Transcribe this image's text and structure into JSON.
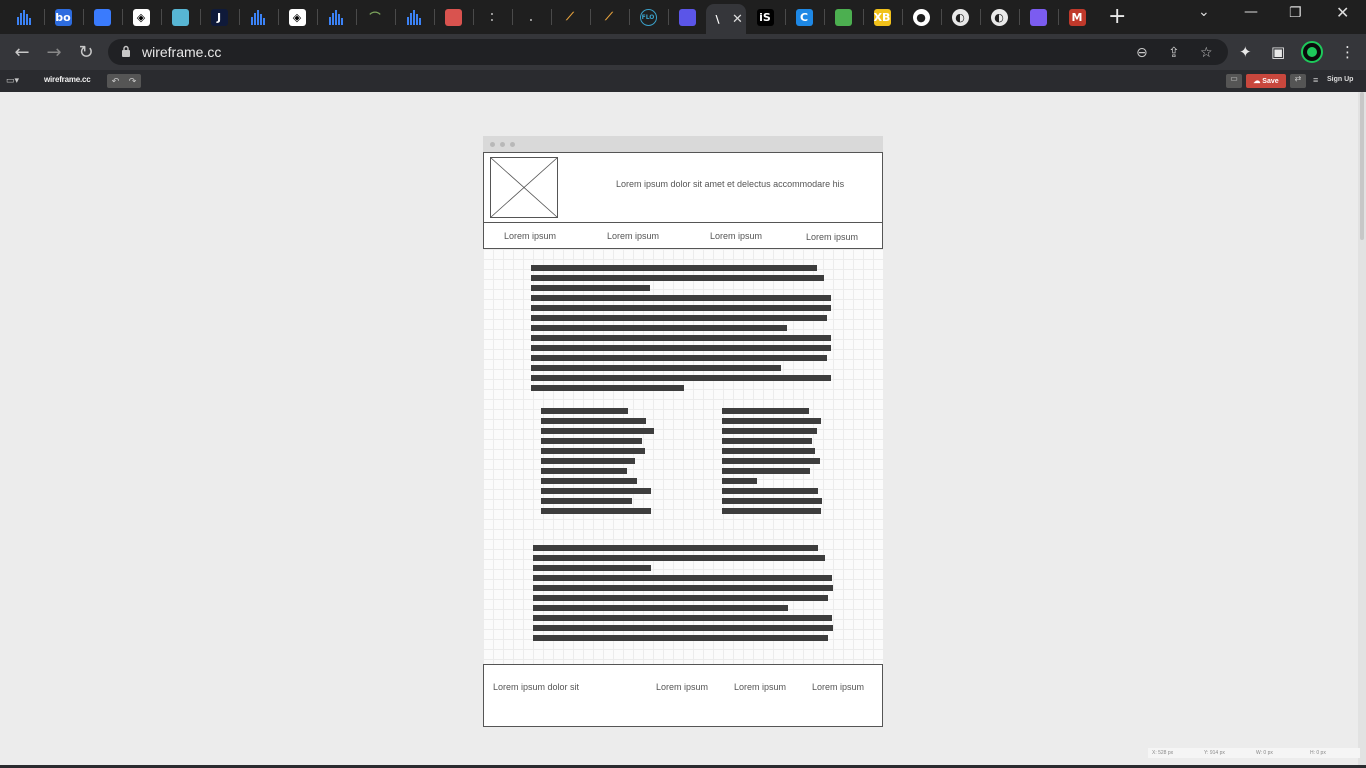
{
  "browser": {
    "url": "wireframe.cc",
    "tabs": [
      {
        "icon": "bar-chart-icon",
        "color": "#3b82f6"
      },
      {
        "icon": "bo-icon",
        "label": "bo",
        "color": "#2d6cdf"
      },
      {
        "icon": "pen-icon",
        "color": "#3a7bfd"
      },
      {
        "icon": "codepen-icon",
        "color": "#ffffff"
      },
      {
        "icon": "image-icon",
        "color": "#57b6d4"
      },
      {
        "icon": "j-icon",
        "label": "J",
        "color": "#0f1a3a"
      },
      {
        "icon": "bar-chart-icon",
        "color": "#3b82f6"
      },
      {
        "icon": "codepen-icon",
        "color": "#ffffff"
      },
      {
        "icon": "bar-chart-icon",
        "color": "#3b82f6"
      },
      {
        "icon": "arc-icon",
        "color": "#7ca45c"
      },
      {
        "icon": "bar-chart-icon",
        "color": "#3b82f6"
      },
      {
        "icon": "diamond-icon",
        "color": "#d9534f"
      },
      {
        "icon": "dots-icon",
        "color": "#999999"
      },
      {
        "icon": "dot-icon",
        "color": "#999999"
      },
      {
        "icon": "feather-icon",
        "color": "#e8a33d"
      },
      {
        "icon": "feather-icon",
        "color": "#e8a33d"
      },
      {
        "icon": "flo-icon",
        "label": "FLO",
        "color": "#3aa0c8"
      },
      {
        "icon": "square-logo-icon",
        "color": "#5b55e8"
      },
      {
        "icon": "wireframe-icon",
        "label": "\\",
        "color": "#35363a"
      },
      {
        "icon": "is-icon",
        "label": "iS",
        "color": "#000000"
      },
      {
        "icon": "c-icon",
        "label": "C",
        "color": "#1e88e5"
      },
      {
        "icon": "frame-icon",
        "color": "#4caf50"
      },
      {
        "icon": "xb-icon",
        "label": "XB",
        "color": "#f2c21b"
      },
      {
        "icon": "github-icon",
        "color": "#ffffff"
      },
      {
        "icon": "globe-icon",
        "color": "#e8e8e8"
      },
      {
        "icon": "globe-icon",
        "color": "#e8e8e8"
      },
      {
        "icon": "app-icon",
        "color": "#7b5cf0"
      },
      {
        "icon": "m-icon",
        "label": "M",
        "color": "#c0392b"
      }
    ]
  },
  "app": {
    "brand": "wireframe.cc",
    "save_label": "Save",
    "signup_label": "Sign Up"
  },
  "wireframe": {
    "header_text": "Lorem ipsum dolor sit amet et delectus accommodare his",
    "nav": [
      "Lorem ipsum",
      "Lorem ipsum",
      "Lorem ipsum",
      "Lorem ipsum"
    ],
    "footer_left": "Lorem ipsum dolor sit",
    "footer_links": [
      "Lorem ipsum",
      "Lorem ipsum",
      "Lorem ipsum"
    ]
  },
  "status": {
    "x": "X: 528 px",
    "y": "Y: 914 px",
    "w": "W: 0 px",
    "h": "H: 0 px"
  }
}
